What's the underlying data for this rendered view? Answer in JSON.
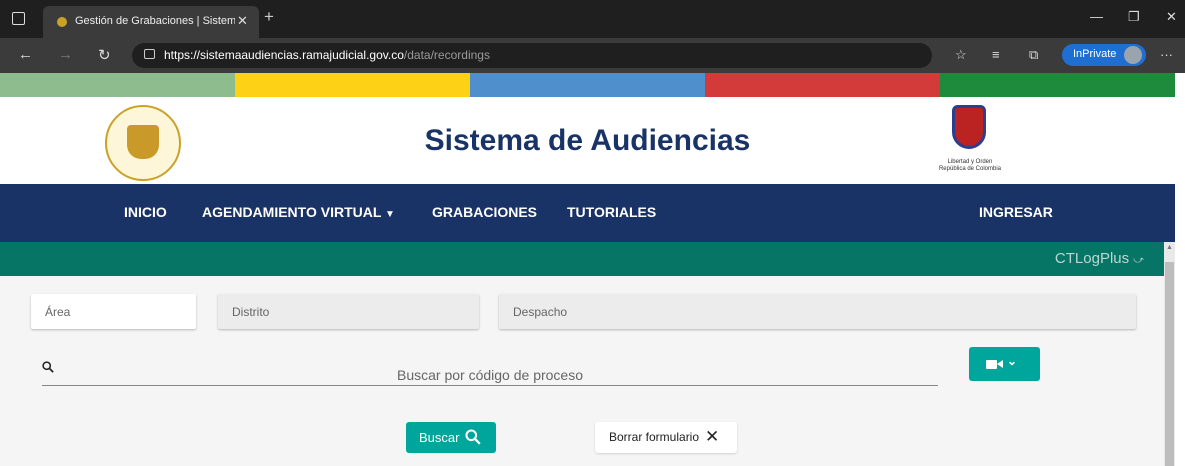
{
  "browser": {
    "tab_title": "Gestión de Grabaciones | Sistema de Audiencias",
    "url_host": "https://sistemaaudiencias.ramajudicial.gov.co",
    "url_path": "/data/recordings",
    "inprivate_label": "InPrivate",
    "icons": [
      "window-icon",
      "tab-favicon",
      "close-icon",
      "plus-icon",
      "minimize-icon",
      "restore-icon",
      "back-icon",
      "forward-icon",
      "refresh-icon",
      "lock-icon",
      "favorite-add-icon",
      "favorites-icon",
      "collections-icon",
      "avatar",
      "more-icon"
    ]
  },
  "colorbar": [
    "#8fbc8f",
    "#fcd116",
    "#4f8fcb",
    "#d33a3a",
    "#1d8a3c"
  ],
  "header": {
    "site_title": "Sistema de Audiencias",
    "shield_text1": "Libertad y Orden",
    "shield_text2": "República de Colombia"
  },
  "nav": {
    "items": [
      "INICIO",
      "AGENDAMIENTO VIRTUAL",
      "GRABACIONES",
      "TUTORIALES"
    ],
    "login": "INGRESAR"
  },
  "brand": {
    "ctlog": "CTLogPlus"
  },
  "form": {
    "area_label": "Área",
    "distrito_label": "Distrito",
    "despacho_label": "Despacho",
    "search_placeholder": "Buscar por código de proceso",
    "buscar_label": "Buscar",
    "borrar_label": "Borrar formulario"
  },
  "colors": {
    "nav_bg": "#1a3366",
    "teal_bar": "#077565",
    "accent": "#00a69c",
    "title": "#1a3366"
  }
}
